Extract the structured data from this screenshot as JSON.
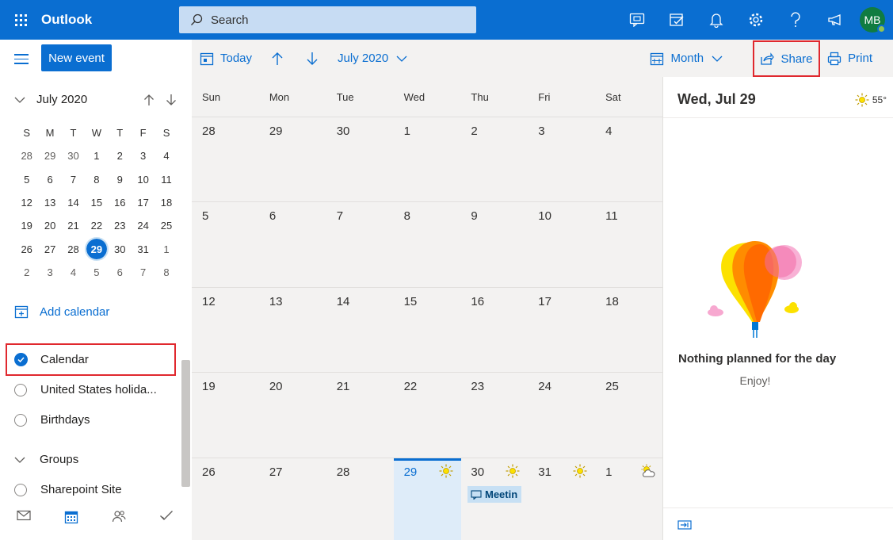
{
  "app": {
    "name": "Outlook",
    "user_initials": "MB"
  },
  "search": {
    "placeholder": "Search"
  },
  "commands": {
    "new_event": "New event",
    "today": "Today",
    "month_label": "July 2020",
    "view": "Month",
    "share": "Share",
    "print": "Print"
  },
  "mini_calendar": {
    "title": "July 2020",
    "weekdays": [
      "S",
      "M",
      "T",
      "W",
      "T",
      "F",
      "S"
    ],
    "weeks": [
      [
        "28",
        "29",
        "30",
        "1",
        "2",
        "3",
        "4"
      ],
      [
        "5",
        "6",
        "7",
        "8",
        "9",
        "10",
        "11"
      ],
      [
        "12",
        "13",
        "14",
        "15",
        "16",
        "17",
        "18"
      ],
      [
        "19",
        "20",
        "21",
        "22",
        "23",
        "24",
        "25"
      ],
      [
        "26",
        "27",
        "28",
        "29",
        "30",
        "31",
        "1"
      ],
      [
        "2",
        "3",
        "4",
        "5",
        "6",
        "7",
        "8"
      ]
    ],
    "selected": "29"
  },
  "nav": {
    "add_calendar": "Add calendar",
    "calendars": [
      {
        "label": "Calendar",
        "checked": true
      },
      {
        "label": "United States holida...",
        "checked": false
      },
      {
        "label": "Birthdays",
        "checked": false
      }
    ],
    "groups_label": "Groups",
    "group_items": [
      {
        "label": "Sharepoint Site"
      }
    ]
  },
  "month_view": {
    "weekdays": [
      "Sun",
      "Mon",
      "Tue",
      "Wed",
      "Thu",
      "Fri",
      "Sat"
    ],
    "weeks": [
      [
        "28",
        "29",
        "30",
        "1",
        "2",
        "3",
        "4"
      ],
      [
        "5",
        "6",
        "7",
        "8",
        "9",
        "10",
        "11"
      ],
      [
        "12",
        "13",
        "14",
        "15",
        "16",
        "17",
        "18"
      ],
      [
        "19",
        "20",
        "21",
        "22",
        "23",
        "24",
        "25"
      ],
      [
        "26",
        "27",
        "28",
        "29",
        "30",
        "31",
        "1"
      ]
    ],
    "event": {
      "label": "Meetin"
    }
  },
  "day_pane": {
    "date": "Wed, Jul 29",
    "temperature": "55°",
    "empty_title": "Nothing planned for the day",
    "empty_subtitle": "Enjoy!"
  },
  "colors": {
    "accent": "#0a6ed1",
    "highlight": "#e0282e"
  }
}
